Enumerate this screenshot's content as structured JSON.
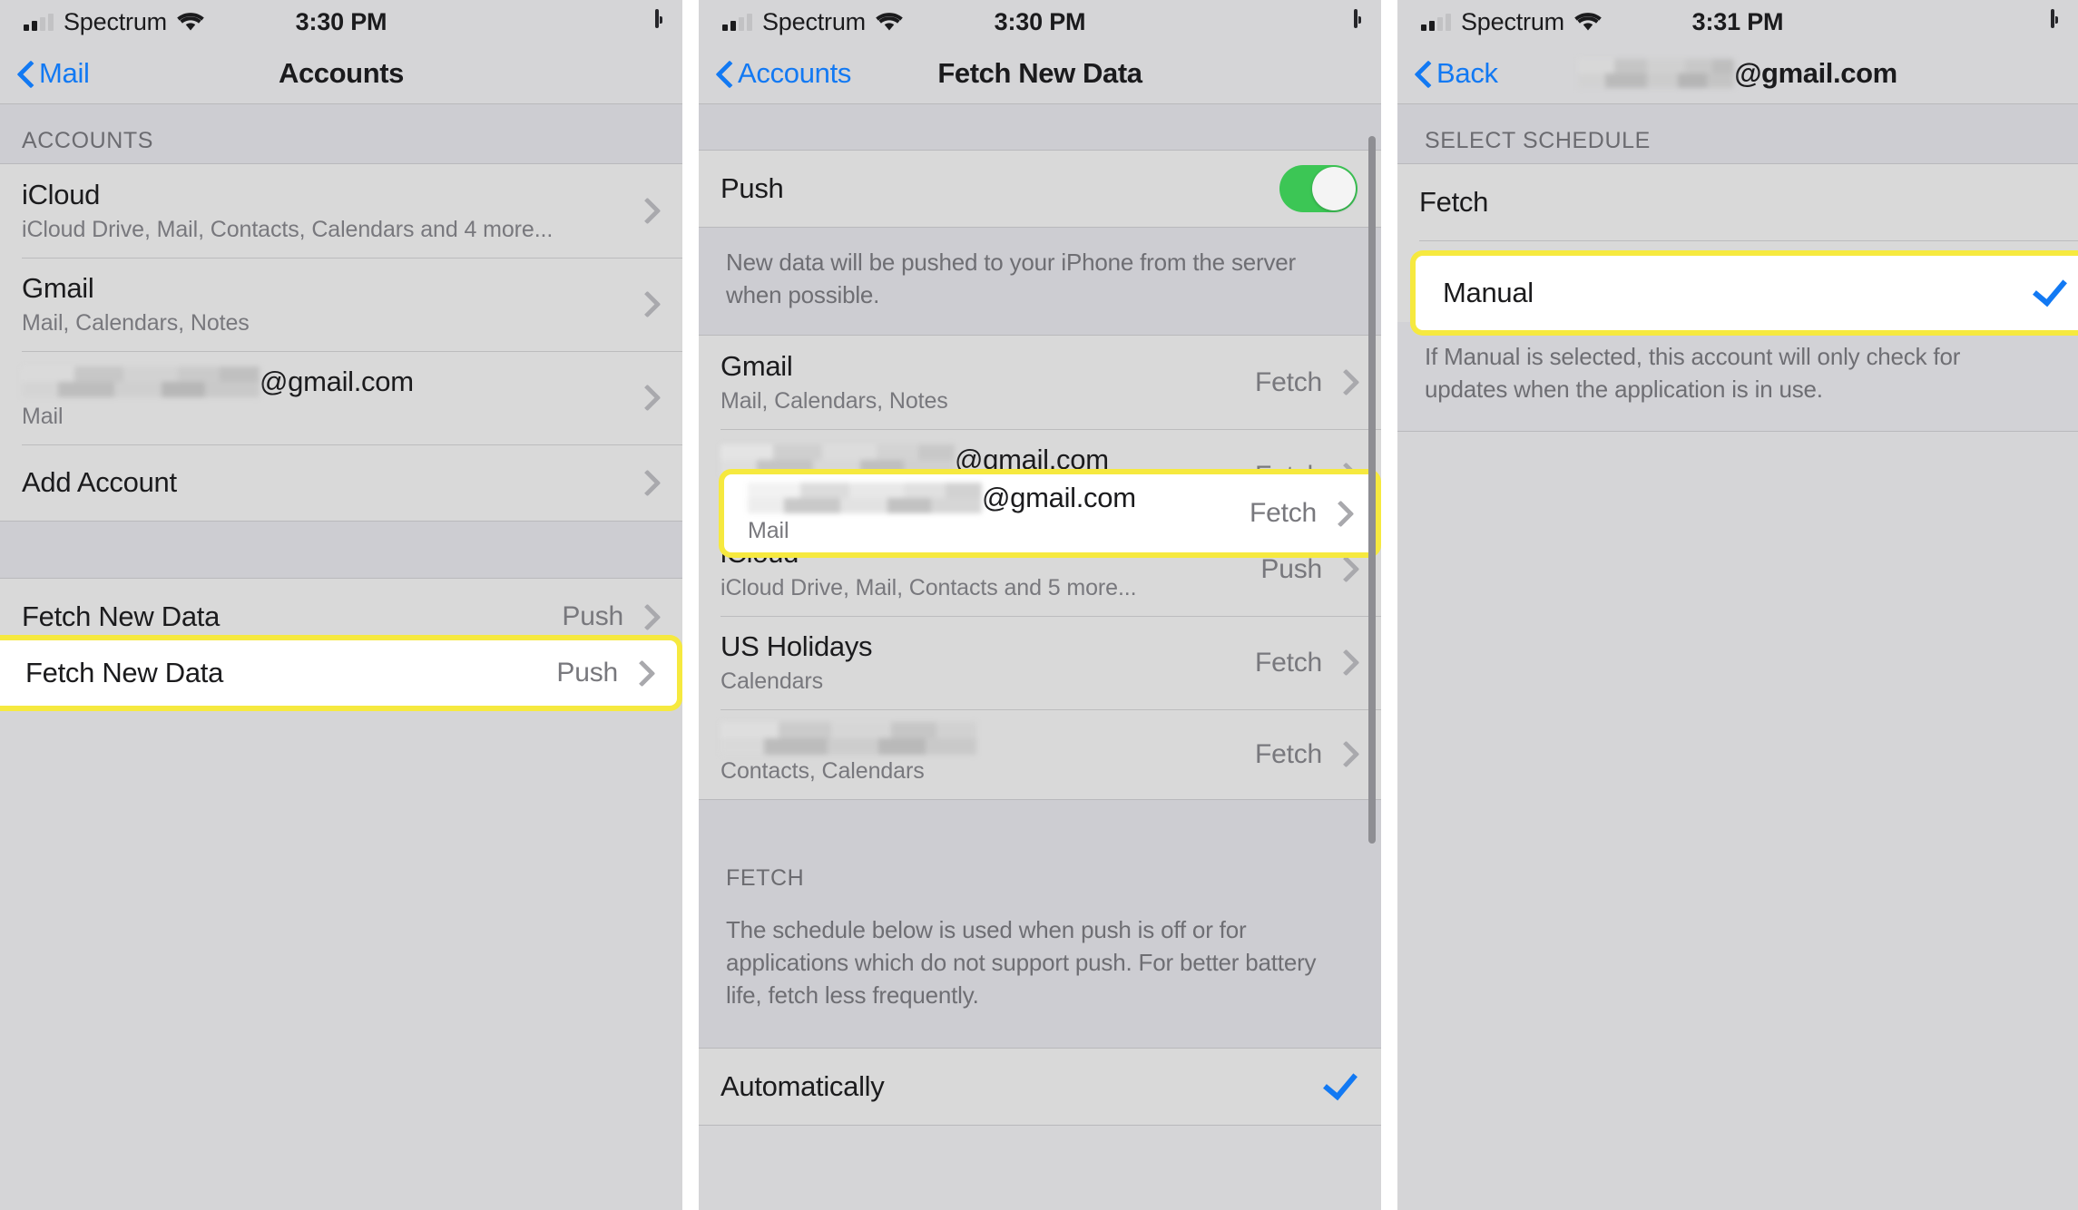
{
  "panels": [
    {
      "status": {
        "carrier": "Spectrum",
        "time": "3:30 PM"
      },
      "nav": {
        "back_label": "Mail",
        "title": "Accounts"
      },
      "section_header": "ACCOUNTS",
      "rows": [
        {
          "title": "iCloud",
          "sub": "iCloud Drive, Mail, Contacts, Calendars and 4 more...",
          "value": ""
        },
        {
          "title": "Gmail",
          "sub": "Mail, Calendars, Notes",
          "value": ""
        },
        {
          "title": "@gmail.com",
          "sub": "Mail",
          "value": "",
          "redacted": true
        },
        {
          "title": "Add Account",
          "sub": "",
          "value": ""
        }
      ],
      "highlighted_row": {
        "title": "Fetch New Data",
        "value": "Push"
      }
    },
    {
      "status": {
        "carrier": "Spectrum",
        "time": "3:30 PM"
      },
      "nav": {
        "back_label": "Accounts",
        "title": "Fetch New Data"
      },
      "push_row": {
        "title": "Push",
        "enabled": true
      },
      "push_note": "New data will be pushed to your iPhone from the server when possible.",
      "accounts": [
        {
          "title": "Gmail",
          "sub": "Mail, Calendars, Notes",
          "value": "Fetch"
        },
        {
          "title": "iCloud",
          "sub": "iCloud Drive, Mail, Contacts and 5 more...",
          "value": "Push"
        },
        {
          "title": "US Holidays",
          "sub": "Calendars",
          "value": "Fetch"
        },
        {
          "title": "",
          "sub": "Contacts, Calendars",
          "value": "Fetch",
          "redacted_title": true
        }
      ],
      "highlighted_row": {
        "title": "@gmail.com",
        "sub": "Mail",
        "value": "Fetch",
        "redacted": true
      },
      "fetch_header": "FETCH",
      "fetch_note": "The schedule below is used when push is off or for applications which do not support push. For better battery life, fetch less frequently.",
      "schedule_rows": [
        {
          "title": "Automatically",
          "selected": true
        }
      ]
    },
    {
      "status": {
        "carrier": "Spectrum",
        "time": "3:31 PM"
      },
      "nav": {
        "back_label": "Back",
        "title": "@gmail.com",
        "redacted": true
      },
      "section_header": "SELECT SCHEDULE",
      "rows": [
        {
          "title": "Fetch",
          "selected": false
        }
      ],
      "highlighted_row": {
        "title": "Manual",
        "selected": true
      },
      "footer_note": "If Manual is selected, this account will only check for updates when the application is in use."
    }
  ],
  "colors": {
    "accent_blue": "#1279f3",
    "toggle_green": "#3cc655",
    "highlight_yellow": "#f6e93f",
    "panel_bg": "#d5d5d7",
    "row_bg": "#d9d9d9",
    "group_bg": "#cdcdd2"
  }
}
